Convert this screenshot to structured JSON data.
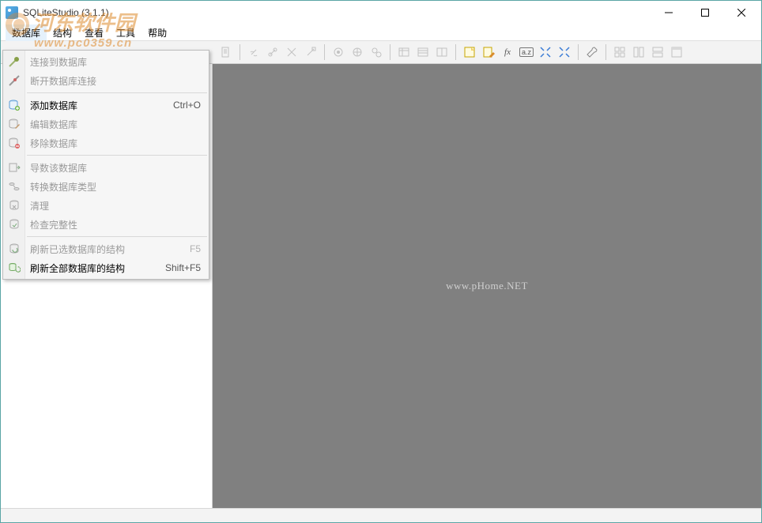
{
  "window": {
    "title": "SQLiteStudio (3.1.1)"
  },
  "menubar": {
    "items": [
      "数据库",
      "结构",
      "查看",
      "工具",
      "帮助"
    ],
    "active_index": 0
  },
  "dropdown": {
    "groups": [
      [
        {
          "icon": "connect-icon",
          "label": "连接到数据库",
          "shortcut": "",
          "enabled": false
        },
        {
          "icon": "disconnect-icon",
          "label": "断开数据库连接",
          "shortcut": "",
          "enabled": false
        }
      ],
      [
        {
          "icon": "db-add-icon",
          "label": "添加数据库",
          "shortcut": "Ctrl+O",
          "enabled": true
        },
        {
          "icon": "db-edit-icon",
          "label": "编辑数据库",
          "shortcut": "",
          "enabled": false
        },
        {
          "icon": "db-remove-icon",
          "label": "移除数据库",
          "shortcut": "",
          "enabled": false
        }
      ],
      [
        {
          "icon": "db-export-icon",
          "label": "导数该数据库",
          "shortcut": "",
          "enabled": false
        },
        {
          "icon": "db-convert-icon",
          "label": "转换数据库类型",
          "shortcut": "",
          "enabled": false
        },
        {
          "icon": "db-vacuum-icon",
          "label": "清理",
          "shortcut": "",
          "enabled": false
        },
        {
          "icon": "db-check-icon",
          "label": "检查完整性",
          "shortcut": "",
          "enabled": false
        }
      ],
      [
        {
          "icon": "refresh-one-icon",
          "label": "刷新已选数据库的结构",
          "shortcut": "F5",
          "enabled": false
        },
        {
          "icon": "refresh-all-icon",
          "label": "刷新全部数据库的结构",
          "shortcut": "Shift+F5",
          "enabled": true
        }
      ]
    ]
  },
  "workspace": {
    "watermark": "www.pHome.NET"
  },
  "corner_watermark": {
    "line1": "河东软件园",
    "line2": "www.pc0359.cn"
  }
}
